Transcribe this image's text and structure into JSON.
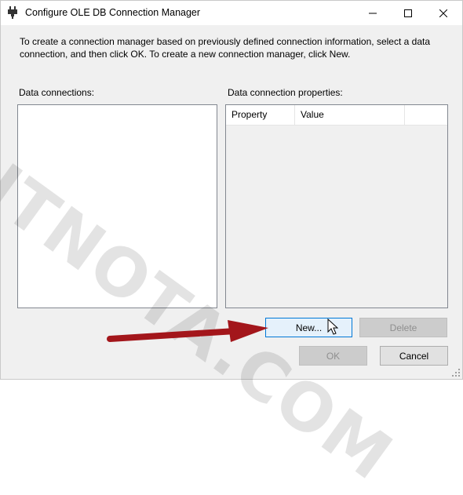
{
  "window": {
    "title": "Configure OLE DB Connection Manager",
    "icon": "plug-icon",
    "controls": [
      "minimize-icon",
      "maximize-icon",
      "close-icon"
    ]
  },
  "intro_text": "To create a connection manager based on previously defined connection information, select a data connection, and then click OK. To create a new connection manager, click New.",
  "data_connections": {
    "label": "Data connections:",
    "items": []
  },
  "connection_properties": {
    "label": "Data connection properties:",
    "columns": [
      "Property",
      "Value",
      ""
    ],
    "rows": []
  },
  "buttons": {
    "new": "New...",
    "delete": "Delete",
    "ok": "OK",
    "cancel": "Cancel"
  },
  "watermark": "ITNOTA.COM",
  "colors": {
    "arrow": "#a3161b",
    "focus_border": "#0078d7",
    "disabled_text": "#8f8f8f"
  }
}
